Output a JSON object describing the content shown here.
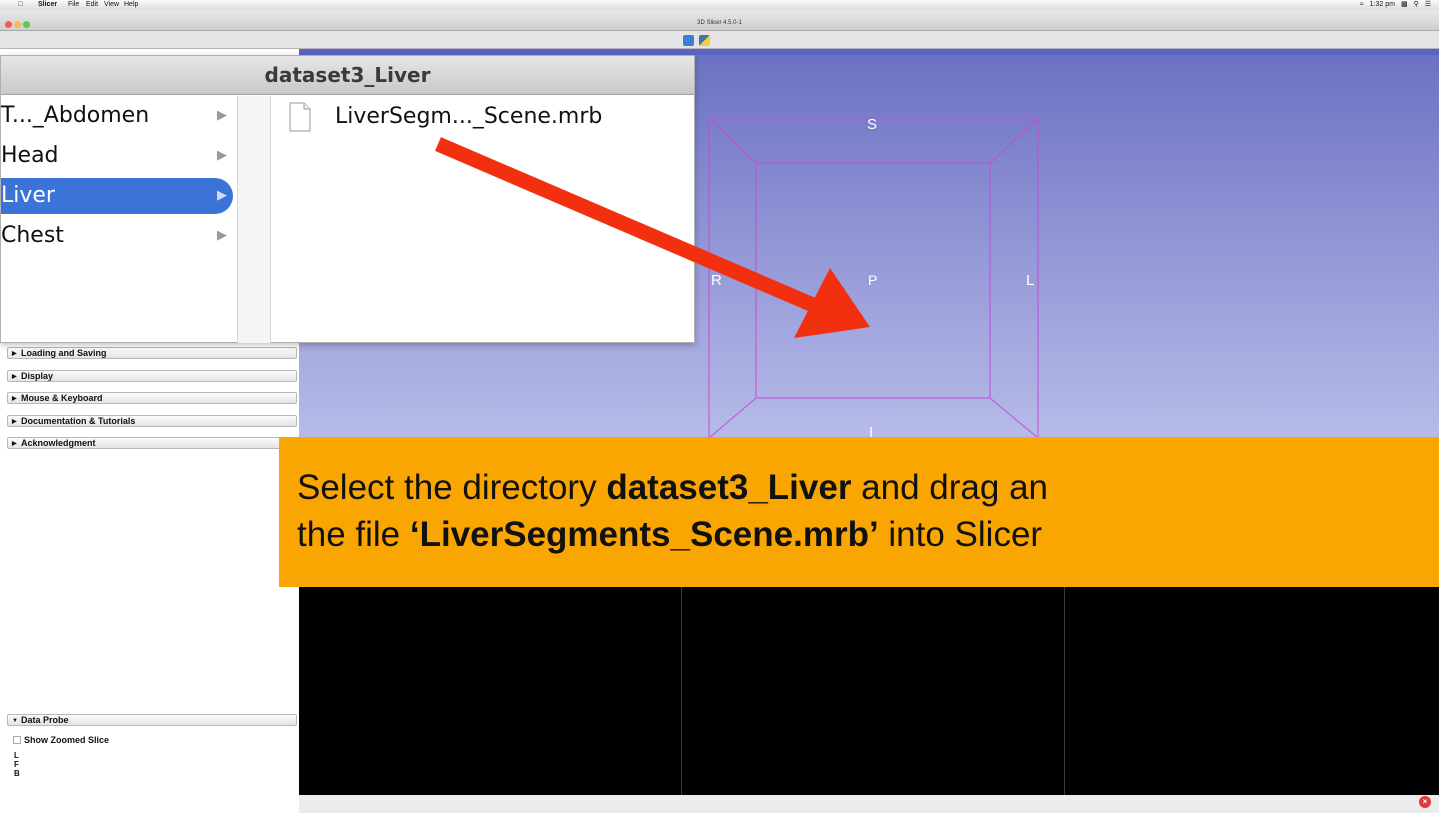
{
  "menubar": {
    "app_name": "Slicer",
    "menus": [
      "File",
      "Edit",
      "View",
      "Help"
    ],
    "clock": "1:32 pm"
  },
  "window": {
    "title": "3D Slicer 4.5.0-1"
  },
  "finder": {
    "title": "dataset3_Liver",
    "folders": [
      {
        "label": "T..._Abdomen",
        "selected": false
      },
      {
        "label": "Head",
        "selected": false
      },
      {
        "label": "Liver",
        "selected": true
      },
      {
        "label": "Chest",
        "selected": false
      }
    ],
    "file": "LiverSegm..._Scene.mrb",
    "expand_glyph": "▶"
  },
  "view3d": {
    "orientation_labels": {
      "top": "S",
      "center": "P",
      "left": "R",
      "right": "L",
      "bottom": "I"
    },
    "box_color": "#c64ad8",
    "arrow_color": "#f2300f"
  },
  "module_panel": {
    "sections": [
      "Loading and Saving",
      "Display",
      "Mouse & Keyboard",
      "Documentation & Tutorials",
      "Acknowledgment"
    ],
    "data_probe": {
      "title": "Data Probe",
      "show_zoomed_slice": "Show Zoomed Slice",
      "labels": [
        "L",
        "F",
        "B"
      ]
    }
  },
  "caption": {
    "line1_prefix": "Select the directory ",
    "line1_bold": "dataset3_Liver",
    "line1_suffix": " and drag an",
    "line2_prefix": "the file ",
    "line2_bold": "‘LiverSegments_Scene.mrb’",
    "line2_suffix": " into Slicer"
  },
  "close_badge": "×"
}
